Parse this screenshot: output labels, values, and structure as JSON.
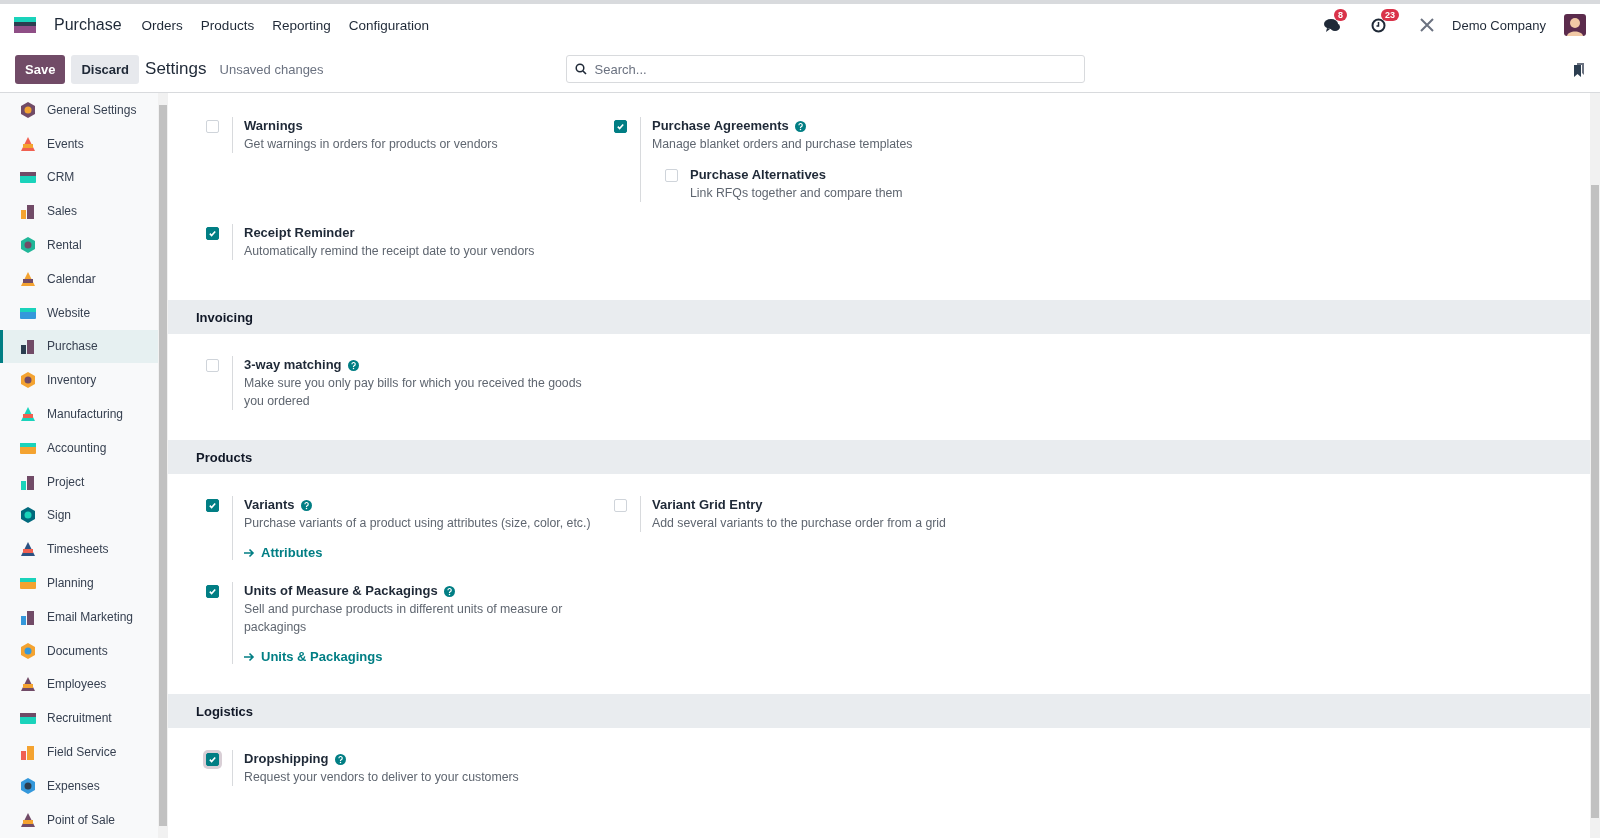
{
  "navbar": {
    "brand": "Purchase",
    "menu": [
      "Orders",
      "Products",
      "Reporting",
      "Configuration"
    ],
    "messages_badge": "8",
    "activities_badge": "23",
    "company": "Demo Company"
  },
  "control_panel": {
    "save": "Save",
    "discard": "Discard",
    "breadcrumb": "Settings",
    "status": "Unsaved changes",
    "search": {
      "placeholder": "Search..."
    }
  },
  "sidebar": {
    "items": [
      {
        "label": "General Settings",
        "selected": false
      },
      {
        "label": "Events",
        "selected": false
      },
      {
        "label": "CRM",
        "selected": false
      },
      {
        "label": "Sales",
        "selected": false
      },
      {
        "label": "Rental",
        "selected": false
      },
      {
        "label": "Calendar",
        "selected": false
      },
      {
        "label": "Website",
        "selected": false
      },
      {
        "label": "Purchase",
        "selected": true
      },
      {
        "label": "Inventory",
        "selected": false
      },
      {
        "label": "Manufacturing",
        "selected": false
      },
      {
        "label": "Accounting",
        "selected": false
      },
      {
        "label": "Project",
        "selected": false
      },
      {
        "label": "Sign",
        "selected": false
      },
      {
        "label": "Timesheets",
        "selected": false
      },
      {
        "label": "Planning",
        "selected": false
      },
      {
        "label": "Email Marketing",
        "selected": false
      },
      {
        "label": "Documents",
        "selected": false
      },
      {
        "label": "Employees",
        "selected": false
      },
      {
        "label": "Recruitment",
        "selected": false
      },
      {
        "label": "Field Service",
        "selected": false
      },
      {
        "label": "Expenses",
        "selected": false
      },
      {
        "label": "Point of Sale",
        "selected": false
      }
    ]
  },
  "sections": [
    {
      "settings": [
        {
          "title": "Warnings",
          "checked": false,
          "help": false,
          "description": "Get warnings in orders for products or vendors"
        },
        {
          "title": "Purchase Agreements",
          "checked": true,
          "help": true,
          "description": "Manage blanket orders and purchase templates",
          "children": [
            {
              "title": "Purchase Alternatives",
              "checked": false,
              "description": "Link RFQs together and compare them"
            }
          ]
        },
        {
          "title": "Receipt Reminder",
          "checked": true,
          "help": false,
          "description": "Automatically remind the receipt date to your vendors"
        }
      ]
    },
    {
      "title": "Invoicing",
      "settings": [
        {
          "title": "3-way matching",
          "checked": false,
          "help": true,
          "description": "Make sure you only pay bills for which you received the goods you ordered"
        }
      ]
    },
    {
      "title": "Products",
      "settings": [
        {
          "title": "Variants",
          "checked": true,
          "help": true,
          "description": "Purchase variants of a product using attributes (size, color, etc.)",
          "link": "Attributes"
        },
        {
          "title": "Variant Grid Entry",
          "checked": false,
          "help": false,
          "description": "Add several variants to the purchase order from a grid"
        },
        {
          "title": "Units of Measure & Packagings",
          "checked": true,
          "help": true,
          "description": "Sell and purchase products in different units of measure or packagings",
          "link": "Units & Packagings"
        }
      ]
    },
    {
      "title": "Logistics",
      "settings": [
        {
          "title": "Dropshipping",
          "checked": true,
          "focused": true,
          "help": true,
          "description": "Request your vendors to deliver to your customers"
        }
      ]
    }
  ]
}
